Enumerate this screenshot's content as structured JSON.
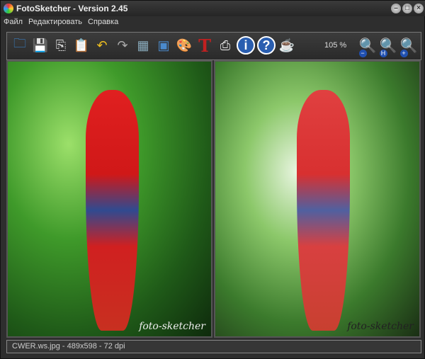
{
  "window": {
    "title": "FotoSketcher - Version 2.45",
    "controls": [
      "minimize",
      "maximize",
      "close"
    ]
  },
  "menu": [
    "Файл",
    "Редактировать",
    "Справка"
  ],
  "toolbar": {
    "buttons": [
      {
        "name": "open-icon",
        "glyph": "🗀",
        "color": "#3a8ee0"
      },
      {
        "name": "save-icon",
        "glyph": "💾",
        "color": "#999"
      },
      {
        "name": "copy-icon",
        "glyph": "⎘",
        "color": "#ddd"
      },
      {
        "name": "paste-icon",
        "glyph": "📋",
        "color": "#c90"
      },
      {
        "name": "undo-icon",
        "glyph": "↶",
        "color": "#f0c020"
      },
      {
        "name": "redo-icon",
        "glyph": "↷",
        "color": "#aaa"
      },
      {
        "name": "original-image-icon",
        "glyph": "▦",
        "color": "#8ab"
      },
      {
        "name": "sketched-image-icon",
        "glyph": "▣",
        "color": "#4a8acc"
      },
      {
        "name": "palette-icon",
        "glyph": "🎨",
        "color": "#e0a030"
      },
      {
        "name": "text-icon",
        "glyph": "T",
        "color": "#c02020"
      },
      {
        "name": "print-icon",
        "glyph": "⎙",
        "color": "#eee"
      },
      {
        "name": "info-icon",
        "glyph": "ⓘ",
        "color": "#3a7ee0"
      },
      {
        "name": "help-icon",
        "glyph": "?",
        "color": "#3a7ee0"
      },
      {
        "name": "coffee-icon",
        "glyph": "☕",
        "color": "#eee"
      }
    ],
    "zoom_level": "105 %",
    "zoom_buttons": [
      {
        "name": "zoom-out-icon",
        "glyph": "−"
      },
      {
        "name": "zoom-fit-icon",
        "glyph": "H"
      },
      {
        "name": "zoom-in-icon",
        "glyph": "+"
      }
    ]
  },
  "panes": {
    "watermark": "foto-sketcher"
  },
  "status": "CWER.ws.jpg - 489x598 - 72 dpi"
}
